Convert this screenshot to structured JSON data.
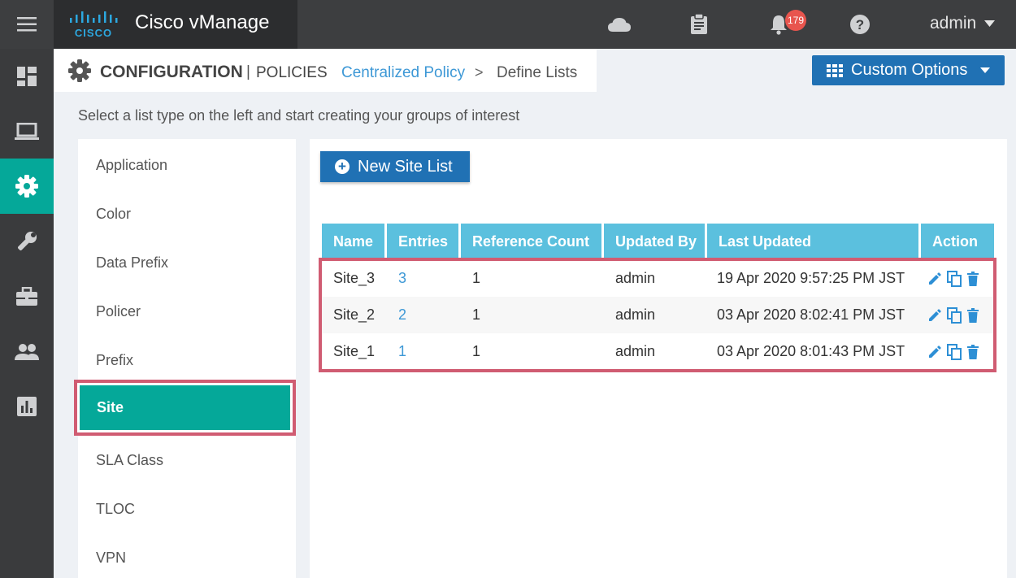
{
  "app": {
    "title": "Cisco vManage",
    "notification_count": "179",
    "user": "admin"
  },
  "header": {
    "section": "CONFIGURATION",
    "separator": "|",
    "subsection": "POLICIES",
    "breadcrumb_link": "Centralized Policy",
    "breadcrumb_arrow": ">",
    "breadcrumb_current": "Define Lists",
    "custom_options_label": "Custom Options"
  },
  "instructions": "Select a list type on the left and start creating your groups of interest",
  "list_types": [
    "Application",
    "Color",
    "Data Prefix",
    "Policer",
    "Prefix",
    "Site",
    "SLA Class",
    "TLOC",
    "VPN"
  ],
  "active_list_type": "Site",
  "new_button_label": "New Site List",
  "table": {
    "columns": [
      "Name",
      "Entries",
      "Reference Count",
      "Updated By",
      "Last Updated",
      "Action"
    ],
    "rows": [
      {
        "name": "Site_3",
        "entries": "3",
        "reference_count": "1",
        "updated_by": "admin",
        "last_updated": "19 Apr 2020 9:57:25 PM JST"
      },
      {
        "name": "Site_2",
        "entries": "2",
        "reference_count": "1",
        "updated_by": "admin",
        "last_updated": "03 Apr 2020 8:02:41 PM JST"
      },
      {
        "name": "Site_1",
        "entries": "1",
        "reference_count": "1",
        "updated_by": "admin",
        "last_updated": "03 Apr 2020 8:01:43 PM JST"
      }
    ]
  },
  "icons": {
    "menu": "hamburger-icon",
    "cloud": "cloud-icon",
    "tasks": "clipboard-icon",
    "alarms": "bell-icon",
    "help": "help-icon",
    "rail": [
      "dashboard-icon",
      "monitor-icon",
      "configuration-gear-icon",
      "tools-wrench-icon",
      "maintenance-briefcase-icon",
      "administration-users-icon",
      "analytics-chart-icon"
    ]
  },
  "colors": {
    "accent_teal": "#05a899",
    "primary_blue": "#2071b4",
    "table_header": "#5bc0de",
    "highlight_border": "#d05c72"
  }
}
